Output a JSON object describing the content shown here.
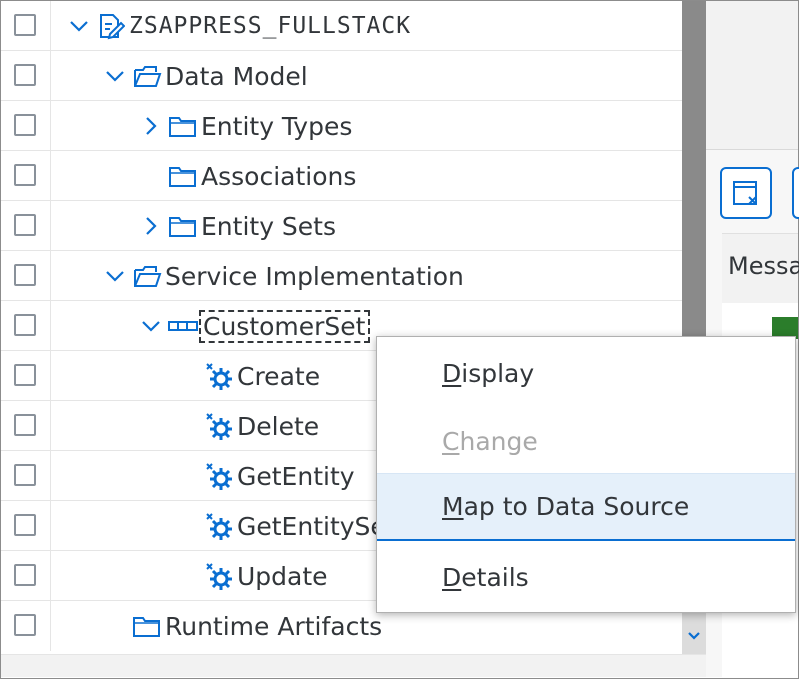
{
  "tree": {
    "root": "ZSAPPRESS_FULLSTACK",
    "items": [
      {
        "label": "Data Model"
      },
      {
        "label": "Entity Types"
      },
      {
        "label": "Associations"
      },
      {
        "label": "Entity Sets"
      },
      {
        "label": "Service Implementation"
      },
      {
        "label": "CustomerSet"
      },
      {
        "label": "Create"
      },
      {
        "label": "Delete"
      },
      {
        "label": "GetEntity"
      },
      {
        "label": "GetEntitySet"
      },
      {
        "label": "Update"
      },
      {
        "label": "Runtime Artifacts"
      }
    ]
  },
  "right_panel": {
    "column_header": "Message"
  },
  "context_menu": {
    "items": [
      {
        "label_first": "D",
        "label_rest": "isplay",
        "enabled": true
      },
      {
        "label_first": "C",
        "label_rest": "hange",
        "enabled": false
      },
      {
        "label_first": "M",
        "label_rest": "ap to Data Source",
        "enabled": true,
        "highlighted": true
      },
      {
        "label_first": "D",
        "label_rest": "etails",
        "enabled": true
      }
    ]
  },
  "colors": {
    "accent": "#0a6ed1",
    "icon": "#0a6ed1",
    "highlight_bg": "#e5f0fa",
    "status_green": "#2b7d2b"
  }
}
